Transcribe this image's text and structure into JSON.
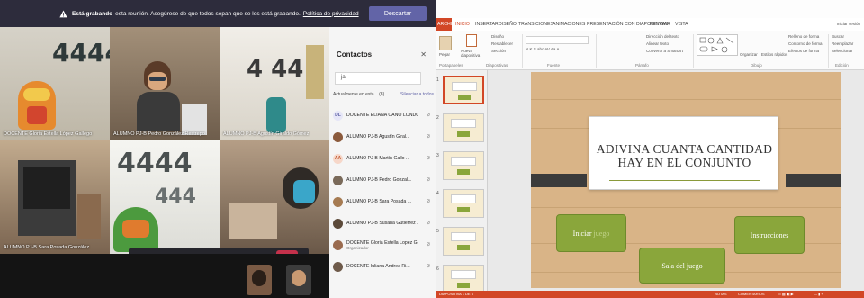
{
  "teams": {
    "banner": {
      "bold": "Está grabando",
      "text": "Está grabando esta reunión. Asegúrese de que todos sepan que se les está grabando.",
      "link": "Política de privacidad",
      "button": "Descartar"
    },
    "tiles": [
      {
        "caption": "DOCENTE Gloria Estella López Gallego"
      },
      {
        "caption": "ALUMNO PJ-B Pedro González Restrepo"
      },
      {
        "caption": "ALUMNO PJ-B Agustín Giraldo Gómez"
      },
      {
        "caption": "ALUMNO PJ-B Sara Posada González"
      }
    ],
    "call_time": "—",
    "panel": {
      "title": "Contactos",
      "search_value": "ja",
      "section_label": "Actualmente en esta... (8)",
      "mute_all": "Silenciar a todos",
      "people": [
        {
          "initials": "DL",
          "name": "DOCENTE ELIANA CANO LONDO...",
          "sub": "",
          "color": "#e6e6f7",
          "fg": "#6264a7"
        },
        {
          "initials": "",
          "name": "ALUMNO PJ-B Agustín Giral...",
          "sub": "",
          "color": "#8b5a3c",
          "fg": "#ffffff"
        },
        {
          "initials": "AA",
          "name": "ALUMNO PJ-B Martín Gallo ...",
          "sub": "",
          "color": "#f6d7c9",
          "fg": "#c25a33"
        },
        {
          "initials": "",
          "name": "ALUMNO PJ-B Pedro Gonzal...",
          "sub": "",
          "color": "#7a6a5a",
          "fg": "#ffffff"
        },
        {
          "initials": "",
          "name": "ALUMNO PJ-B Sara Posada ...",
          "sub": "",
          "color": "#a67b52",
          "fg": "#ffffff"
        },
        {
          "initials": "",
          "name": "ALUMNO PJ-B Susana Gutierrez ...",
          "sub": "",
          "color": "#5c4a3a",
          "fg": "#ffffff"
        },
        {
          "initials": "",
          "name": "DOCENTE Gloria Estella Lopez Gal...",
          "sub": "Organizador",
          "color": "#9a6b4f",
          "fg": "#ffffff"
        },
        {
          "initials": "",
          "name": "DOCENTE Iuliana Andrea Ri...",
          "sub": "",
          "color": "#6e5a4a",
          "fg": "#ffffff"
        }
      ]
    }
  },
  "ppt": {
    "tabs": [
      "ARCHIVO",
      "INICIO",
      "INSERTAR",
      "DISEÑO",
      "TRANSICIONES",
      "ANIMACIONES",
      "PRESENTACIÓN CON DIAPOSITIVAS",
      "REVISAR",
      "VISTA"
    ],
    "active_tab": "INICIO",
    "signin": "Iniciar sesión",
    "groups": [
      "Portapapeles",
      "Diapositivas",
      "Fuente",
      "Párrafo",
      "Dibujo",
      "Edición"
    ],
    "ribbon_items": {
      "pegar": "Pegar",
      "nueva": "Nueva diapositiva",
      "diseno": "Diseño",
      "restablecer": "Restablecer",
      "seccion": "Sección",
      "direccion": "Dirección del texto",
      "alinear": "Alinear texto",
      "smartart": "Convertir a SmartArt",
      "organizar": "Organizar",
      "estilos": "Estilos rápidos",
      "relleno": "Relleno de forma",
      "contorno": "Contorno de forma",
      "efectos": "Efectos de forma",
      "buscar": "Buscar",
      "reemplazar": "Reemplazar",
      "seleccionar": "Seleccionar"
    },
    "slide_numbers": [
      "1",
      "2",
      "3",
      "4",
      "5",
      "6"
    ],
    "slide": {
      "title_line1": "ADIVINA CUANTA  CANTIDAD",
      "title_line2": "HAY EN EL CONJUNTO",
      "btn_iniciar": "Iniciar",
      "btn_iniciar_dim": "juego",
      "btn_instrucciones": "Instrucciones",
      "btn_salida": "Sala del juego"
    },
    "status": {
      "left": "DIAPOSITIVA 1 DE 6",
      "notes": "NOTAS",
      "comments": "COMENTARIOS"
    },
    "colors": {
      "accent": "#d24726",
      "button": "#8aa63b",
      "wood": "#d9b487"
    }
  }
}
